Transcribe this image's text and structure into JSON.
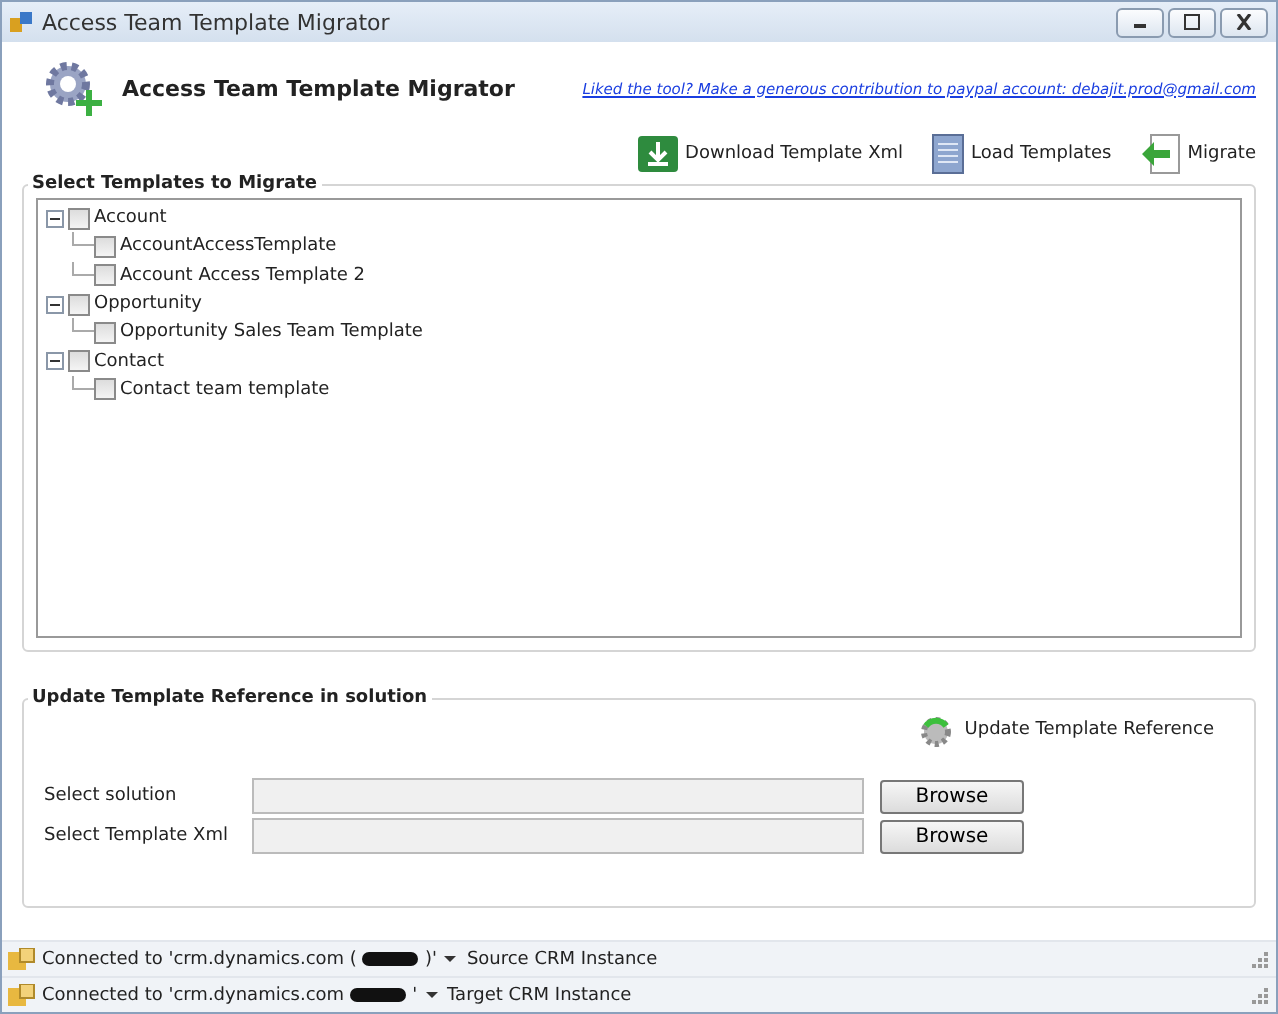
{
  "window": {
    "title": "Access Team Template Migrator"
  },
  "header": {
    "title": "Access Team Template Migrator",
    "link": "Liked the tool? Make a generous contribution to paypal account: debajit.prod@gmail.com"
  },
  "toolbar": [
    {
      "kind": "download",
      "label": "Download Template Xml"
    },
    {
      "kind": "load",
      "label": "Load Templates"
    },
    {
      "kind": "migrate",
      "label": "Migrate"
    }
  ],
  "templates": {
    "title": "Select Templates to Migrate",
    "tree": [
      {
        "label": "Account",
        "checked": false,
        "expanded": true,
        "children": [
          {
            "label": "AccountAccessTemplate",
            "checked": false
          },
          {
            "label": "Account Access Template 2",
            "checked": false
          }
        ]
      },
      {
        "label": "Opportunity",
        "checked": false,
        "expanded": true,
        "children": [
          {
            "label": "Opportunity Sales Team Template",
            "checked": false
          }
        ]
      },
      {
        "label": "Contact",
        "checked": false,
        "expanded": true,
        "children": [
          {
            "label": "Contact team template",
            "checked": false
          }
        ]
      }
    ]
  },
  "update": {
    "title": "Update Template Reference in solution",
    "action": "Update Template Reference",
    "fields": [
      {
        "label": "Select solution",
        "button": "Browse"
      },
      {
        "label": "Select Template Xml",
        "button": "Browse"
      }
    ]
  },
  "status_bar": [
    {
      "prefix": "Connected to 'crm.dynamics.com (",
      "suffix": ")'",
      "instance": "Source CRM Instance"
    },
    {
      "prefix": "Connected to 'crm.dynamics.com",
      "suffix": "'",
      "instance": "Target CRM Instance"
    }
  ]
}
